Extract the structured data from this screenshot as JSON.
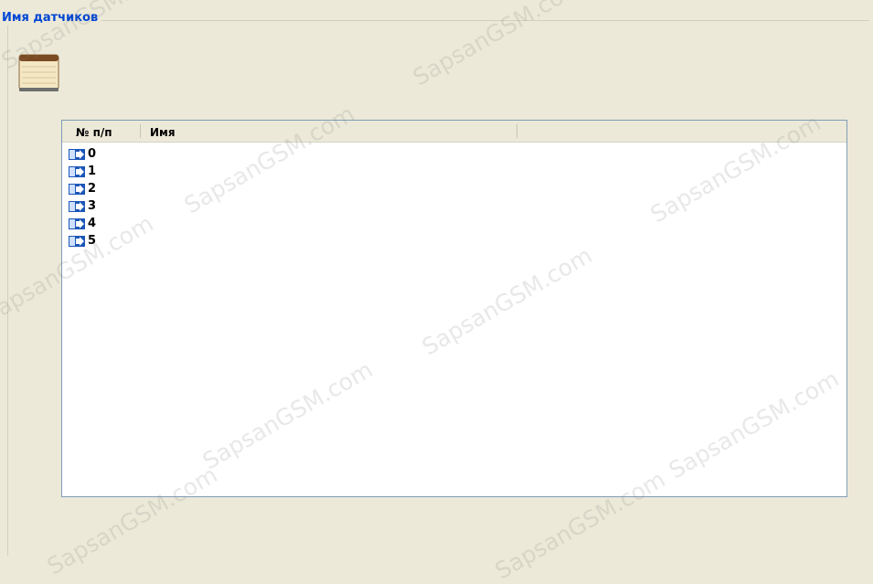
{
  "group": {
    "title": "Имя датчиков"
  },
  "list": {
    "columns": [
      "№ п/п",
      "Имя"
    ],
    "rows": [
      {
        "num": "0",
        "name": ""
      },
      {
        "num": "1",
        "name": ""
      },
      {
        "num": "2",
        "name": ""
      },
      {
        "num": "3",
        "name": ""
      },
      {
        "num": "4",
        "name": ""
      },
      {
        "num": "5",
        "name": ""
      }
    ],
    "row_icon": "arrow-right-icon"
  },
  "icons": {
    "header_icon": "notebook-icon"
  },
  "watermark": {
    "text": "SapsanGSM.com"
  }
}
